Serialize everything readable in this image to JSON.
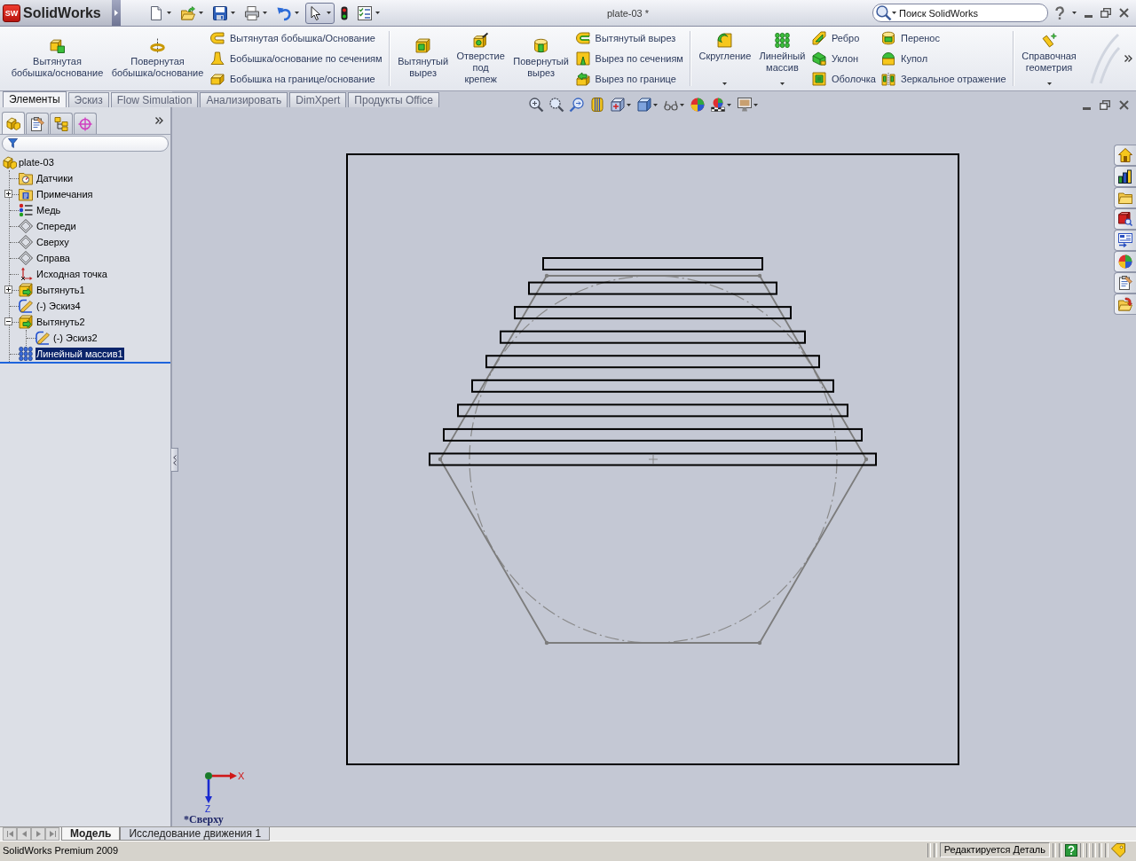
{
  "title_bar": {
    "logo_badge": "SW",
    "app_name": "SolidWorks",
    "document_title": "plate-03 *",
    "search": {
      "placeholder": "Поиск SolidWorks"
    }
  },
  "quick_access": [
    {
      "kind": "new",
      "dropdown": true,
      "selected": false
    },
    {
      "kind": "open",
      "dropdown": true,
      "selected": false
    },
    {
      "kind": "save",
      "dropdown": true,
      "selected": false
    },
    {
      "kind": "print",
      "dropdown": true,
      "selected": false
    },
    {
      "kind": "undo",
      "dropdown": true,
      "selected": false
    },
    {
      "kind": "select",
      "dropdown": true,
      "selected": true
    },
    {
      "kind": "rebuild",
      "dropdown": false,
      "selected": false
    },
    {
      "kind": "options",
      "dropdown": true,
      "selected": false
    }
  ],
  "command_manager": {
    "groups": [
      {
        "columns": [
          {
            "kind": "large",
            "label": "Вытянутая бобышка/основание",
            "dropdown": false
          },
          {
            "kind": "large",
            "label": "Повернутая бобышка/основание",
            "dropdown": false
          },
          {
            "kind": "stack",
            "items": [
              {
                "label": "Вытянутая бобышка/Основание"
              },
              {
                "label": "Бобышка/основание по сечениям"
              },
              {
                "label": "Бобышка на границе/основание"
              }
            ]
          }
        ]
      },
      {
        "columns": [
          {
            "kind": "large",
            "label": "Вытянутый вырез",
            "dropdown": false
          },
          {
            "kind": "large",
            "label": "Отверстие под крепеж",
            "dropdown": false
          },
          {
            "kind": "large",
            "label": "Повернутый вырез",
            "dropdown": false
          },
          {
            "kind": "stack",
            "items": [
              {
                "label": "Вытянутый вырез"
              },
              {
                "label": "Вырез по сечениям"
              },
              {
                "label": "Вырез по границе"
              }
            ]
          }
        ]
      },
      {
        "columns": [
          {
            "kind": "large",
            "label": "Скругление",
            "dropdown": true
          },
          {
            "kind": "large",
            "label": "Линейный массив",
            "dropdown": true
          },
          {
            "kind": "stack",
            "items": [
              {
                "label": "Ребро"
              },
              {
                "label": "Уклон"
              },
              {
                "label": "Оболочка"
              }
            ]
          },
          {
            "kind": "stack",
            "items": [
              {
                "label": "Перенос"
              },
              {
                "label": "Купол"
              },
              {
                "label": "Зеркальное отражение"
              }
            ]
          }
        ]
      },
      {
        "columns": [
          {
            "kind": "large",
            "label": "Справочная геометрия",
            "dropdown": true
          }
        ]
      }
    ]
  },
  "tabs": [
    {
      "label": "Элементы",
      "selected": true
    },
    {
      "label": "Эскиз",
      "selected": false
    },
    {
      "label": "Flow Simulation",
      "selected": false
    },
    {
      "label": "Анализировать",
      "selected": false
    },
    {
      "label": "DimXpert",
      "selected": false
    },
    {
      "label": "Продукты Office",
      "selected": false
    }
  ],
  "feature_manager": {
    "panel_tabs": [
      {
        "kind": "features",
        "selected": true
      },
      {
        "kind": "properties",
        "selected": false
      },
      {
        "kind": "configurations",
        "selected": false
      },
      {
        "kind": "dimxpert",
        "selected": false
      }
    ],
    "tree": {
      "label": "plate-03",
      "kind": "part",
      "selected": false,
      "children": [
        {
          "label": "Датчики",
          "kind": "sensors",
          "selected": false
        },
        {
          "label": "Примечания",
          "kind": "annotations",
          "selected": false,
          "expanded": false
        },
        {
          "label": "Медь",
          "kind": "material",
          "selected": false
        },
        {
          "label": "Спереди",
          "kind": "plane",
          "selected": false
        },
        {
          "label": "Сверху",
          "kind": "plane",
          "selected": false
        },
        {
          "label": "Справа",
          "kind": "plane",
          "selected": false
        },
        {
          "label": "Исходная точка",
          "kind": "origin",
          "selected": false
        },
        {
          "label": "Вытянуть1",
          "kind": "extrude",
          "selected": false,
          "expanded": false
        },
        {
          "label": "(-) Эскиз4",
          "kind": "sketch",
          "selected": false
        },
        {
          "label": "Вытянуть2",
          "kind": "extrude",
          "selected": false,
          "expanded": true,
          "children": [
            {
              "label": "(-) Эскиз2",
              "kind": "sketch",
              "selected": false
            }
          ]
        },
        {
          "label": "Линейный массив1",
          "kind": "pattern",
          "selected": true
        }
      ]
    }
  },
  "graphics": {
    "triad": {
      "x_label": "X",
      "z_label": "Z"
    },
    "view_name": "*Сверху"
  },
  "bottom_tabs": [
    {
      "label": "Модель",
      "selected": true
    },
    {
      "label": "Исследование движения 1",
      "selected": false
    }
  ],
  "status_bar": {
    "product": "SolidWorks Premium 2009",
    "mode": "Редактируется Деталь"
  }
}
